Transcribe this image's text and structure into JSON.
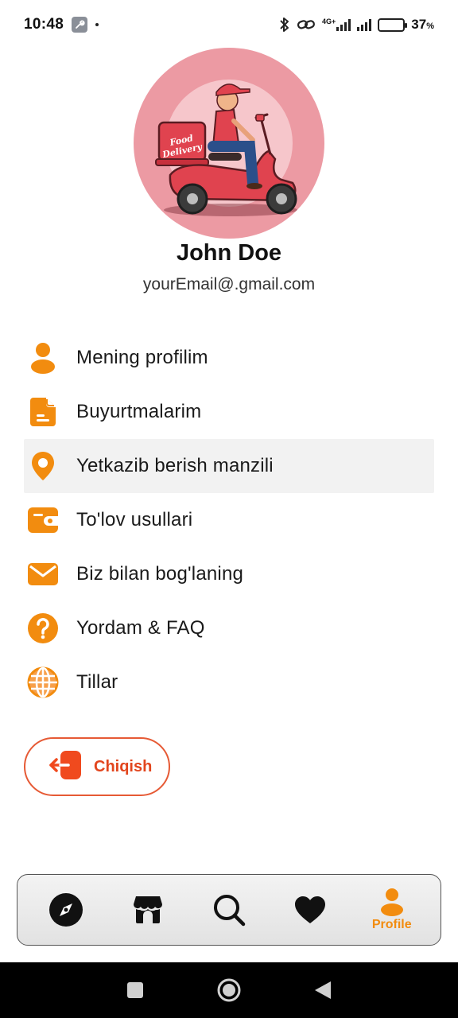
{
  "status_bar": {
    "time": "10:48",
    "network_label": "4G+",
    "battery_percent": "37",
    "battery_unit": "%",
    "battery_level": 0.37
  },
  "profile": {
    "name": "John Doe",
    "email": "yourEmail@.gmail.com",
    "avatar_text_line1": "Food",
    "avatar_text_line2": "Delivery"
  },
  "menu": {
    "items": [
      {
        "label": "Mening profilim",
        "icon": "person-icon"
      },
      {
        "label": "Buyurtmalarim",
        "icon": "document-icon"
      },
      {
        "label": "Yetkazib berish manzili",
        "icon": "location-pin-icon"
      },
      {
        "label": "To'lov usullari",
        "icon": "wallet-icon"
      },
      {
        "label": "Biz bilan bog'laning",
        "icon": "mail-icon"
      },
      {
        "label": "Yordam & FAQ",
        "icon": "help-icon"
      },
      {
        "label": "Tillar",
        "icon": "globe-icon"
      }
    ]
  },
  "logout": {
    "label": "Chiqish",
    "icon": "logout-icon"
  },
  "bottom_nav": {
    "items": [
      {
        "icon": "compass-icon"
      },
      {
        "icon": "store-icon"
      },
      {
        "icon": "search-icon"
      },
      {
        "icon": "heart-icon"
      },
      {
        "icon": "profile-icon",
        "label": "Profile"
      }
    ]
  },
  "colors": {
    "accent": "#f28c0f",
    "logout": "#e2451d",
    "avatar_bg": "#ec9aa3",
    "active_row": "#f2f2f2"
  }
}
